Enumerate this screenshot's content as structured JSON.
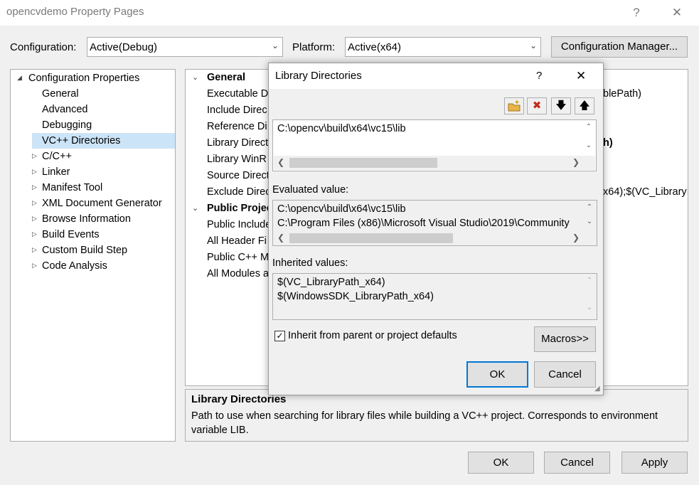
{
  "window": {
    "title": "opencvdemo Property Pages",
    "help_label": "?",
    "close_label": "✕"
  },
  "config_bar": {
    "configuration_label": "Configuration:",
    "configuration_value": "Active(Debug)",
    "platform_label": "Platform:",
    "platform_value": "Active(x64)",
    "config_manager_label": "Configuration Manager..."
  },
  "tree": {
    "root": "Configuration Properties",
    "children": [
      "General",
      "Advanced",
      "Debugging",
      "VC++ Directories"
    ],
    "collapsed": [
      "C/C++",
      "Linker",
      "Manifest Tool",
      "XML Document Generator",
      "Browse Information",
      "Build Events",
      "Custom Build Step",
      "Code Analysis"
    ],
    "selected": "VC++ Directories"
  },
  "grid": {
    "general_header": "General",
    "general_rows": [
      "Executable D",
      "Include Direc",
      "Reference Di",
      "Library Direct",
      "Library WinR",
      "Source Direct",
      "Exclude Direc"
    ],
    "right_values": {
      "executable": "blePath)",
      "library": "h)",
      "exclude": "x64);$(VC_LibraryI"
    },
    "public_header": "Public Projec",
    "public_rows": [
      "Public Include",
      "All Header Fi",
      "Public C++ M",
      "All Modules a"
    ]
  },
  "description": {
    "title": "Library Directories",
    "text": "Path to use when searching for library files while building a VC++ project.  Corresponds to environment variable LIB."
  },
  "bottom_buttons": {
    "ok": "OK",
    "cancel": "Cancel",
    "apply": "Apply"
  },
  "dialog": {
    "title": "Library Directories",
    "help_label": "?",
    "close_label": "✕",
    "edit_value": "C:\\opencv\\build\\x64\\vc15\\lib",
    "evaluated_label": "Evaluated value:",
    "evaluated_lines": [
      "C:\\opencv\\build\\x64\\vc15\\lib",
      "C:\\Program Files (x86)\\Microsoft Visual Studio\\2019\\Community"
    ],
    "inherited_label": "Inherited values:",
    "inherited_lines": [
      "$(VC_LibraryPath_x64)",
      "$(WindowsSDK_LibraryPath_x64)"
    ],
    "inherit_checkbox_label": "Inherit from parent or project defaults",
    "inherit_checked": true,
    "macros_label": "Macros>>",
    "ok": "OK",
    "cancel": "Cancel"
  },
  "colors": {
    "selection": "#cce4f7",
    "accent": "#0078d7",
    "delete_red": "#c42b1c"
  }
}
